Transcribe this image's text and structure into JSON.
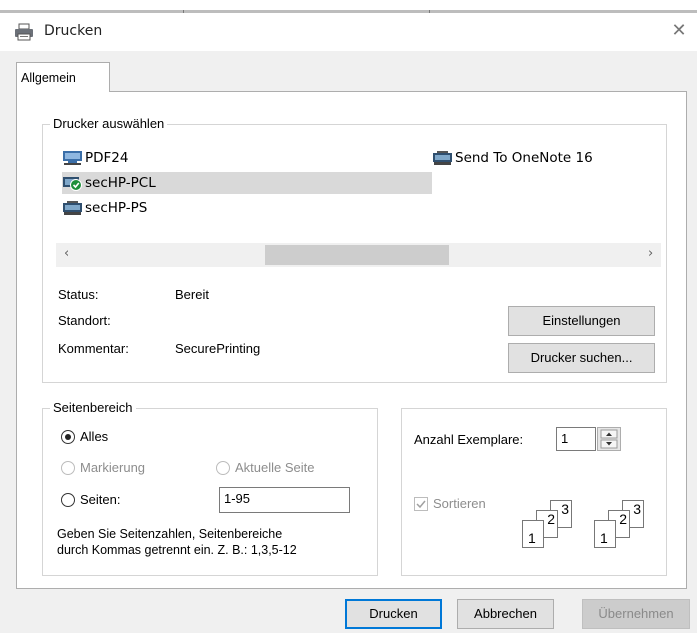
{
  "window": {
    "title": "Drucken"
  },
  "tabs": [
    {
      "label": "Allgemein"
    }
  ],
  "printer_group": {
    "legend": "Drucker auswählen",
    "printers": [
      {
        "name": "PDF24"
      },
      {
        "name": "secHP-PCL"
      },
      {
        "name": "secHP-PS"
      },
      {
        "name": "Send To OneNote 16"
      }
    ]
  },
  "status": {
    "status_label": "Status:",
    "status_value": "Bereit",
    "location_label": "Standort:",
    "location_value": "",
    "comment_label": "Kommentar:",
    "comment_value": "SecurePrinting"
  },
  "buttons": {
    "settings": "Einstellungen",
    "find_printer": "Drucker suchen...",
    "print": "Drucken",
    "cancel": "Abbrechen",
    "apply": "Übernehmen"
  },
  "page_range": {
    "legend": "Seitenbereich",
    "all": "Alles",
    "selection": "Markierung",
    "current_page": "Aktuelle Seite",
    "pages": "Seiten:",
    "pages_value": "1-95",
    "hint_line1": "Geben Sie Seitenzahlen, Seitenbereiche",
    "hint_line2": "durch Kommas getrennt ein. Z. B.: 1,3,5-12"
  },
  "copies": {
    "label": "Anzahl Exemplare:",
    "value": "1",
    "collate": "Sortieren",
    "collate_digits": [
      "1",
      "2",
      "3"
    ]
  },
  "colors": {
    "accent": "#0078d7",
    "selection": "#d9d9d9"
  }
}
